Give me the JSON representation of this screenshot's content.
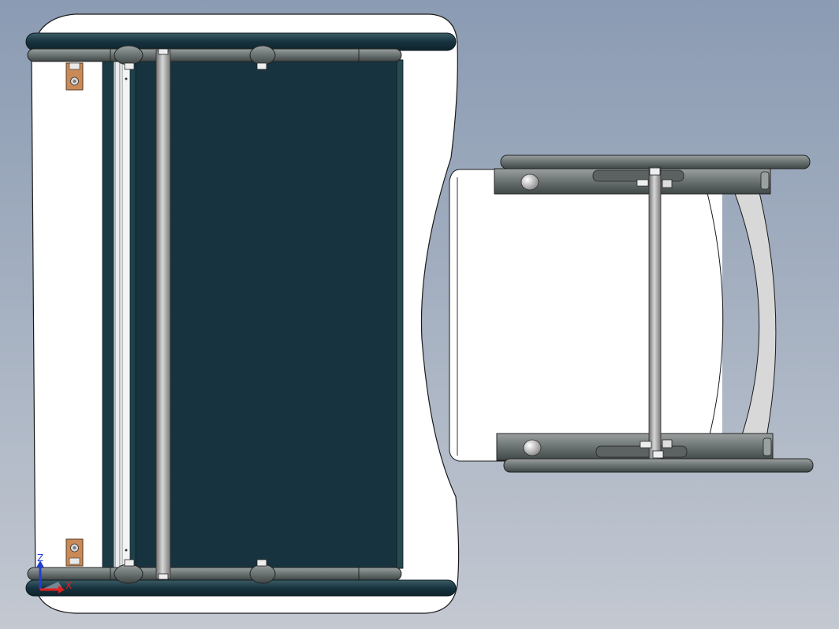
{
  "viewport": {
    "background_top": "#8b9bb3",
    "background_bottom": "#c3c8d1"
  },
  "model": {
    "board_color": "#16333f",
    "tube_color": "#4f5a5c",
    "rod_color": "#a9a9a9",
    "bracket_color": "#c98a58",
    "outline_color": "#1a1a1a"
  },
  "triad": {
    "z_label": "Z",
    "x_label": "X",
    "z_color": "#1f3fd0",
    "x_color": "#e02020"
  }
}
